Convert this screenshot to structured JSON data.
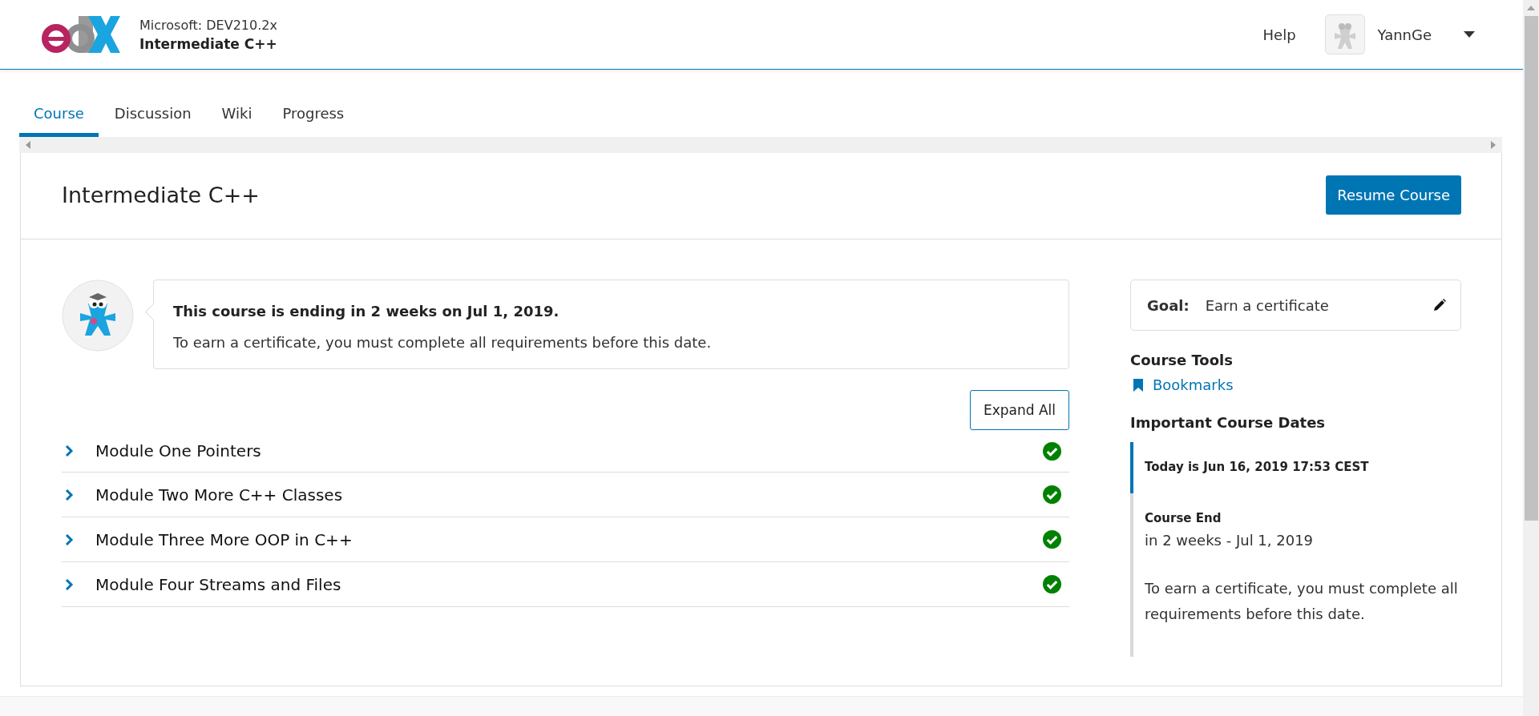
{
  "header": {
    "org": "Microsoft: DEV210.2x",
    "course": "Intermediate C++",
    "help": "Help",
    "user": "YannGe"
  },
  "tabs": [
    {
      "label": "Course",
      "selected": true
    },
    {
      "label": "Discussion",
      "selected": false
    },
    {
      "label": "Wiki",
      "selected": false
    },
    {
      "label": "Progress",
      "selected": false
    }
  ],
  "course": {
    "title": "Intermediate C++",
    "resume_button": "Resume Course"
  },
  "welcome": {
    "heading": "This course is ending in 2 weeks on Jul 1, 2019.",
    "text": "To earn a certificate, you must complete all requirements before this date."
  },
  "expand_button": "Expand All",
  "modules": [
    {
      "title": "Module One Pointers",
      "expanded": false,
      "completed": true
    },
    {
      "title": "Module Two More C++ Classes",
      "expanded": false,
      "completed": true
    },
    {
      "title": "Module Three More OOP in C++",
      "expanded": false,
      "completed": true
    },
    {
      "title": "Module Four Streams and Files",
      "expanded": false,
      "completed": true
    }
  ],
  "sidebar": {
    "goal_label": "Goal:",
    "goal": "Earn a certificate",
    "tools_heading": "Course Tools",
    "tools": [
      "Bookmarks"
    ],
    "dates_heading": "Important Course Dates",
    "dates": [
      {
        "kind": "today",
        "title": "Today is Jun 16, 2019 17:53 CEST"
      },
      {
        "kind": "date",
        "title": "Course End",
        "date": "in 2 weeks - Jul 1, 2019",
        "description": "To earn a certificate, you must complete all requirements before this date."
      }
    ]
  }
}
